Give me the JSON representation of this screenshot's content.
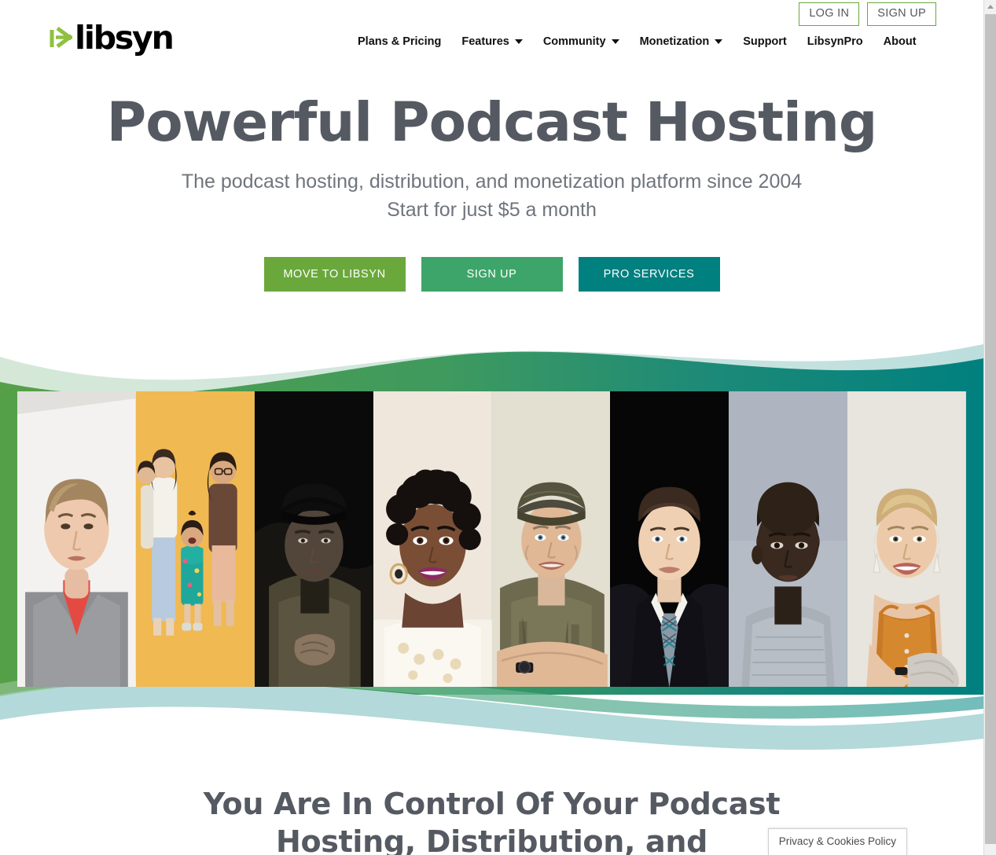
{
  "brand": {
    "name": "libsyn",
    "logo_icon": "libsyn-asterisk-logo",
    "accent_green": "#6aa83c",
    "accent_teal": "#00807f"
  },
  "topbar": {
    "login_label": "LOG IN",
    "signup_label": "SIGN UP"
  },
  "nav": {
    "items": [
      {
        "label": "Plans & Pricing",
        "has_dropdown": false
      },
      {
        "label": "Features",
        "has_dropdown": true
      },
      {
        "label": "Community",
        "has_dropdown": true
      },
      {
        "label": "Monetization",
        "has_dropdown": true
      },
      {
        "label": "Support",
        "has_dropdown": false
      },
      {
        "label": "LibsynPro",
        "has_dropdown": false
      },
      {
        "label": "About",
        "has_dropdown": false
      }
    ]
  },
  "hero": {
    "title": "Powerful Podcast Hosting",
    "subtitle_line1": "The podcast hosting, distribution, and monetization platform since 2004",
    "subtitle_line2": "Start for just $5 a month",
    "buttons": [
      {
        "label": "MOVE TO LIBSYN",
        "color": "#6aa83c"
      },
      {
        "label": "SIGN UP",
        "color": "#3ea56a"
      },
      {
        "label": "PRO SERVICES",
        "color": "#00807f"
      }
    ]
  },
  "gallery": {
    "alt_labels": [
      "podcaster-portrait-man-red-shirt-grey-blazer",
      "podcaster-portrait-family-group-yellow-backdrop",
      "podcaster-portrait-man-black-cap-dark-moody",
      "podcaster-portrait-woman-curly-hair-smiling",
      "podcaster-portrait-man-cap-olive-tshirt",
      "podcaster-portrait-man-suit-plaid-tie",
      "podcaster-portrait-man-grey-sweater",
      "podcaster-portrait-blonde-woman-orange-top"
    ]
  },
  "lower": {
    "heading_line1": "You Are In Control Of Your Podcast",
    "heading_line2": "Hosting, Distribution, and"
  },
  "cookie_notice": {
    "label": "Privacy & Cookies Policy"
  },
  "scrollbar": {
    "up_arrow_icon": "scroll-up-arrow-icon"
  }
}
